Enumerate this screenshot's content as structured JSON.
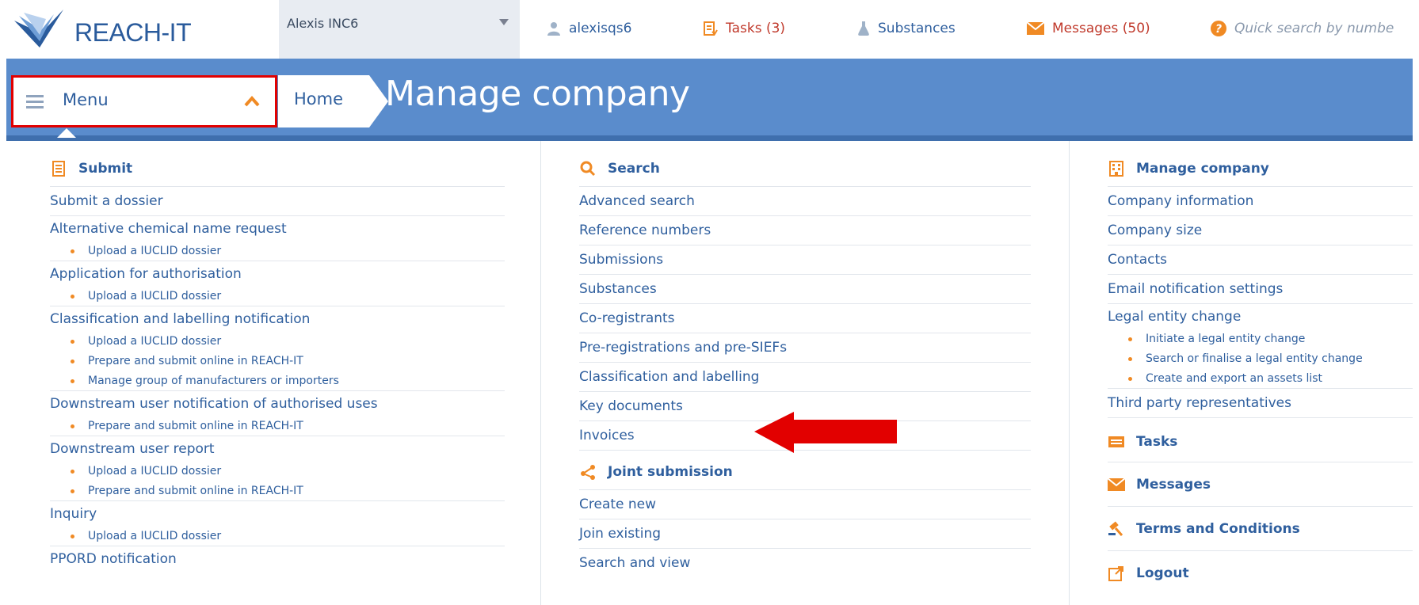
{
  "header": {
    "logo_text": "REACH-IT",
    "company_select": "Alexis INC6",
    "user": "alexisqs6",
    "tasks": "Tasks (3)",
    "substances": "Substances",
    "messages": "Messages (50)",
    "quick_search": "Quick search by numbe"
  },
  "band": {
    "menu_label": "Menu",
    "home_label": "Home",
    "page_title": "Manage company"
  },
  "columns": {
    "submit": {
      "title": "Submit",
      "icon": "document-list-icon",
      "items": [
        {
          "label": "Submit a dossier",
          "subs": []
        },
        {
          "label": "Alternative chemical name request",
          "subs": [
            "Upload a IUCLID dossier"
          ]
        },
        {
          "label": "Application for authorisation",
          "subs": [
            "Upload a IUCLID dossier"
          ]
        },
        {
          "label": "Classification and labelling notification",
          "subs": [
            "Upload a IUCLID dossier",
            "Prepare and submit online in REACH-IT",
            "Manage group of manufacturers or importers"
          ]
        },
        {
          "label": "Downstream user notification of authorised uses",
          "subs": [
            "Prepare and submit online in REACH-IT"
          ]
        },
        {
          "label": "Downstream user report",
          "subs": [
            "Upload a IUCLID dossier",
            "Prepare and submit online in REACH-IT"
          ]
        },
        {
          "label": "Inquiry",
          "subs": [
            "Upload a IUCLID dossier"
          ]
        },
        {
          "label": "PPORD notification",
          "subs": []
        }
      ]
    },
    "search": {
      "title": "Search",
      "icon": "search-icon",
      "items": [
        "Advanced search",
        "Reference numbers",
        "Submissions",
        "Substances",
        "Co-registrants",
        "Pre-registrations and pre-SIEFs",
        "Classification and labelling",
        "Key documents",
        "Invoices"
      ]
    },
    "joint": {
      "title": "Joint submission",
      "icon": "share-icon",
      "items": [
        "Create new",
        "Join existing",
        "Search and view"
      ]
    },
    "manage": {
      "title": "Manage company",
      "icon": "building-icon",
      "items": [
        {
          "label": "Company information",
          "subs": []
        },
        {
          "label": "Company size",
          "subs": []
        },
        {
          "label": "Contacts",
          "subs": []
        },
        {
          "label": "Email notification settings",
          "subs": []
        },
        {
          "label": "Legal entity change",
          "subs": [
            "Initiate a legal entity change",
            "Search or finalise a legal entity change",
            "Create and export an assets list"
          ]
        },
        {
          "label": "Third party representatives",
          "subs": []
        }
      ]
    },
    "extra_sections": [
      {
        "title": "Tasks",
        "icon": "tasks-icon"
      },
      {
        "title": "Messages",
        "icon": "envelope-icon"
      },
      {
        "title": "Terms and Conditions",
        "icon": "gavel-icon"
      },
      {
        "title": "Logout",
        "icon": "logout-icon"
      }
    ]
  },
  "colors": {
    "brand_blue": "#5a8ccc",
    "link_blue": "#2f5f9e",
    "accent_orange": "#f08a24",
    "alert_red": "#c0392b",
    "highlight_red": "#e20000"
  }
}
